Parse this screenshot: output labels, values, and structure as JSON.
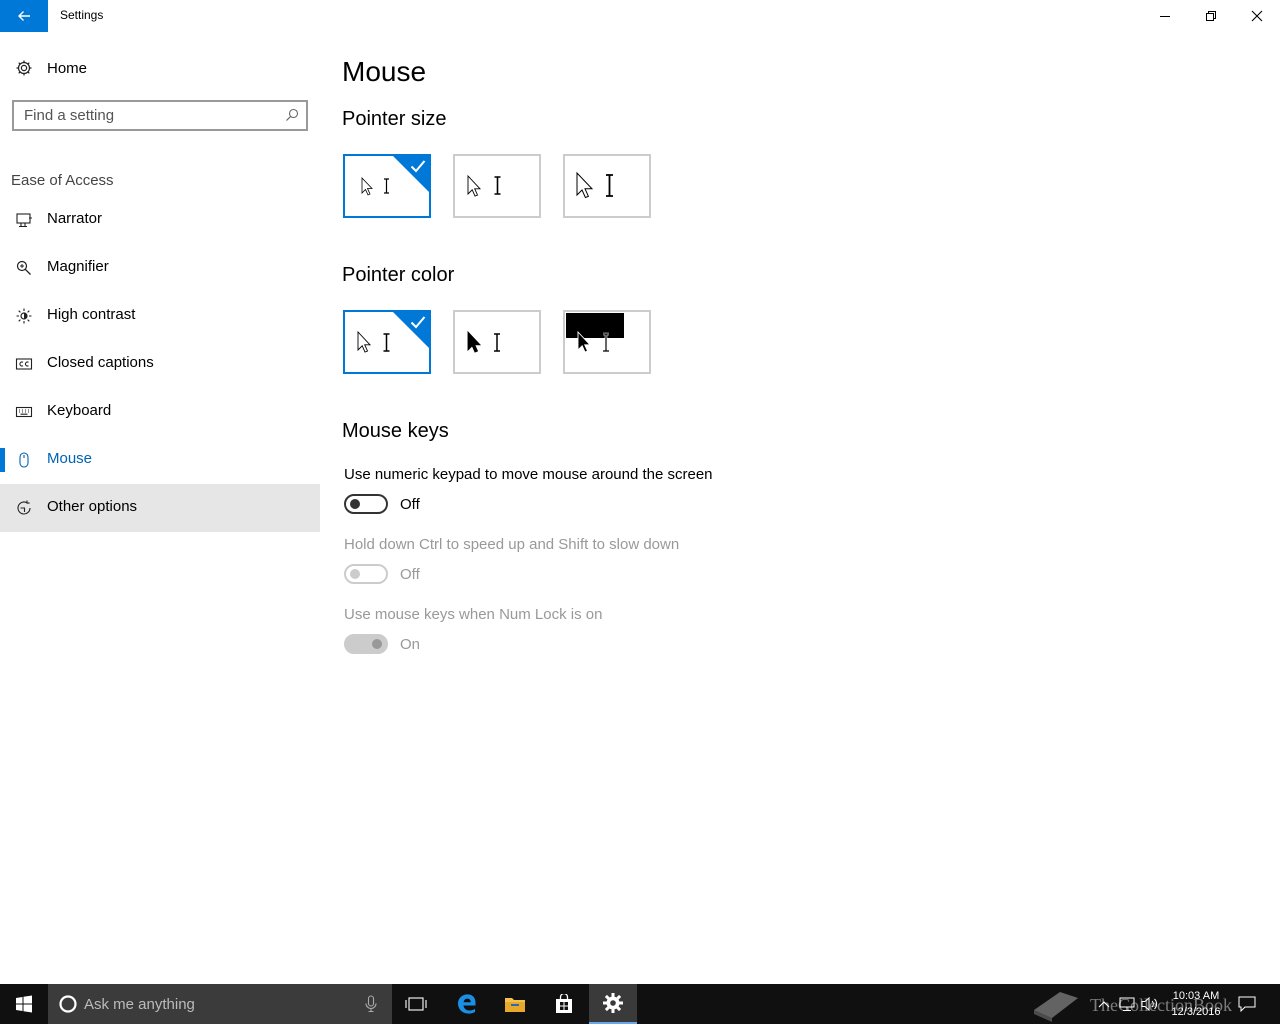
{
  "window": {
    "title": "Settings"
  },
  "sidebar": {
    "home_label": "Home",
    "search_placeholder": "Find a setting",
    "section_title": "Ease of Access",
    "items": [
      {
        "label": "Narrator",
        "icon": "narrator-icon"
      },
      {
        "label": "Magnifier",
        "icon": "magnifier-icon"
      },
      {
        "label": "High contrast",
        "icon": "high-contrast-icon"
      },
      {
        "label": "Closed captions",
        "icon": "closed-captions-icon"
      },
      {
        "label": "Keyboard",
        "icon": "keyboard-icon"
      },
      {
        "label": "Mouse",
        "icon": "mouse-icon",
        "selected": true
      },
      {
        "label": "Other options",
        "icon": "other-options-icon",
        "hover": true
      }
    ]
  },
  "main": {
    "title": "Mouse",
    "pointer_size": {
      "heading": "Pointer size",
      "options": [
        "small",
        "medium",
        "large"
      ],
      "selected": "small"
    },
    "pointer_color": {
      "heading": "Pointer color",
      "options": [
        "white",
        "black",
        "inverted"
      ],
      "selected": "white"
    },
    "mouse_keys": {
      "heading": "Mouse keys",
      "settings": [
        {
          "label": "Use numeric keypad to move mouse around the screen",
          "state": "Off",
          "enabled": true
        },
        {
          "label": "Hold down Ctrl to speed up and Shift to slow down",
          "state": "Off",
          "enabled": false
        },
        {
          "label": "Use mouse keys when Num Lock is on",
          "state": "On",
          "enabled": false
        }
      ]
    }
  },
  "taskbar": {
    "search_placeholder": "Ask me anything",
    "time": "10:03 AM",
    "date": "12/3/2016",
    "watermark": "TheCollectionBook",
    "colors": {
      "background": "#101010",
      "accent": "#0078d7"
    }
  }
}
